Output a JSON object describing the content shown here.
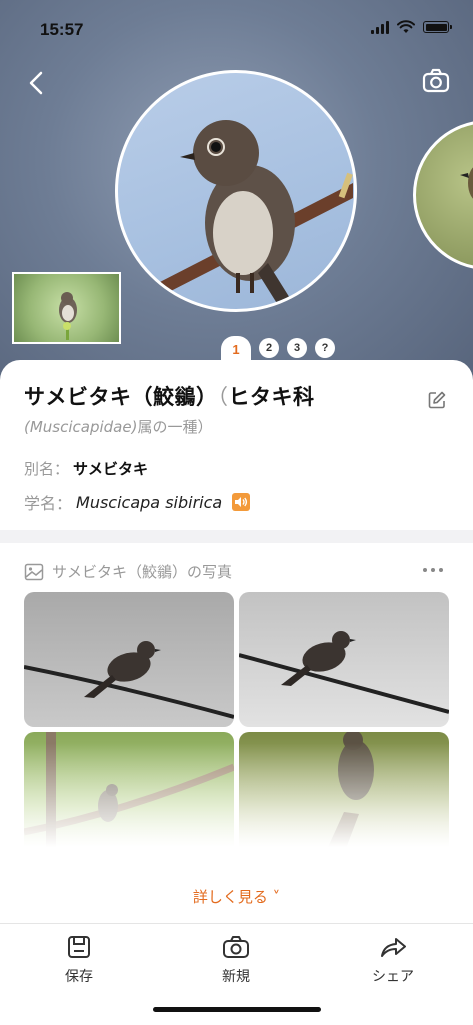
{
  "status": {
    "time": "15:57"
  },
  "hero": {
    "dots": [
      "1",
      "2",
      "3",
      "?"
    ],
    "active_dot": 0
  },
  "species": {
    "title": "サメビタキ（鮫鶲）",
    "family_open": "（",
    "family_jp": "ヒタキ科",
    "family_latin": "(Muscicapidae)",
    "family_suffix": "属の一種）",
    "alias_label": "別名：",
    "alias_value": "サメビタキ",
    "sci_label": "学名：",
    "sci_value": "Muscicapa sibirica"
  },
  "photos": {
    "header": "サメビタキ（鮫鶲）の写真",
    "see_more": "詳しく見る ˅"
  },
  "tabs": [
    {
      "label": "保存",
      "icon": "save-icon"
    },
    {
      "label": "新規",
      "icon": "camera-icon"
    },
    {
      "label": "シェア",
      "icon": "share-icon"
    }
  ],
  "colors": {
    "accent": "#e36b1e",
    "speaker": "#f39a3a"
  }
}
